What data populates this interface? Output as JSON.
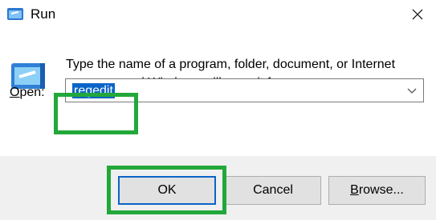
{
  "window": {
    "title": "Run",
    "title_icon": "run-icon",
    "close_icon": "close-icon"
  },
  "dialog": {
    "description": "Type the name of a program, folder, document, or Internet resource, and Windows will open it for you.",
    "open_label_underlined": "O",
    "open_label_rest": "pen:",
    "input_value": "regedit",
    "dropdown_icon": "chevron-down-icon"
  },
  "buttons": {
    "ok": "OK",
    "cancel": "Cancel",
    "browse_underlined": "B",
    "browse_rest": "rowse..."
  },
  "colors": {
    "highlight": "#22a83a",
    "accent": "#0a64c8",
    "footer_bg": "#f0f0f0"
  }
}
